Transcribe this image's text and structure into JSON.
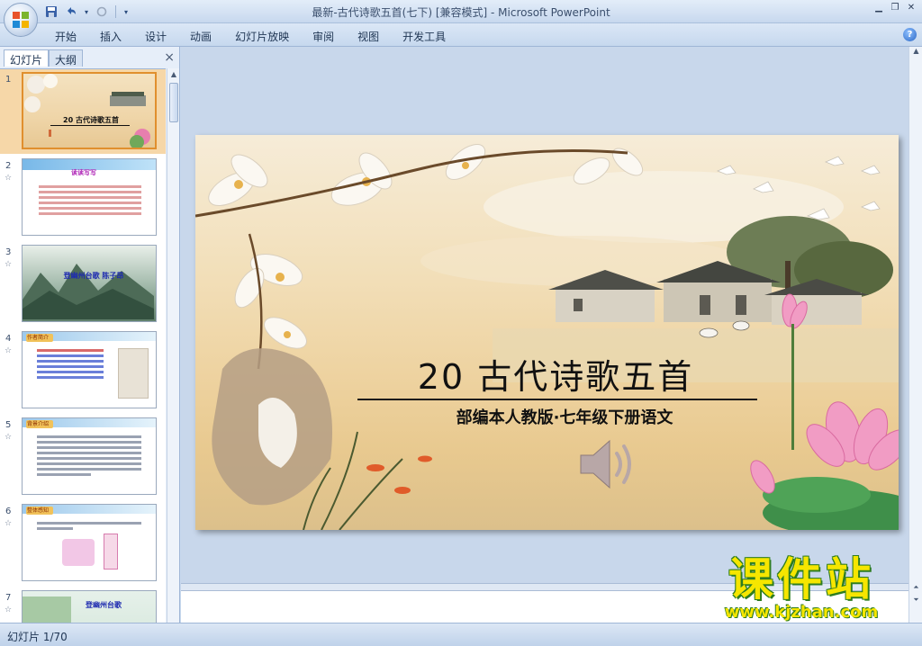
{
  "window": {
    "title": "最新-古代诗歌五首(七下) [兼容模式] - Microsoft PowerPoint"
  },
  "ribbon": {
    "tabs": [
      "开始",
      "插入",
      "设计",
      "动画",
      "幻灯片放映",
      "审阅",
      "视图",
      "开发工具"
    ]
  },
  "panel": {
    "tab_slides": "幻灯片",
    "tab_outline": "大纲",
    "close": "×",
    "thumbnails": [
      {
        "num": "1",
        "caption": "20 古代诗歌五首"
      },
      {
        "num": "2",
        "caption": "读读写写"
      },
      {
        "num": "3",
        "caption": "登幽州台歌 陈子昂"
      },
      {
        "num": "4",
        "caption": "作者简介"
      },
      {
        "num": "5",
        "caption": "背景介绍"
      },
      {
        "num": "6",
        "caption": "整体感知"
      },
      {
        "num": "7",
        "caption": "登幽州台歌"
      }
    ]
  },
  "slide": {
    "title": "20  古代诗歌五首",
    "subtitle": "部编本人教版·七年级下册语文"
  },
  "status": {
    "slide_indicator": "幻灯片 1/70"
  },
  "watermark": {
    "name": "课件站",
    "url": "www.kjzhan.com"
  },
  "icons": {
    "office": "office-button-icon",
    "save": "save-icon",
    "undo": "undo-icon",
    "redo": "redo-icon",
    "speaker": "speaker-icon",
    "help": "help-icon"
  }
}
